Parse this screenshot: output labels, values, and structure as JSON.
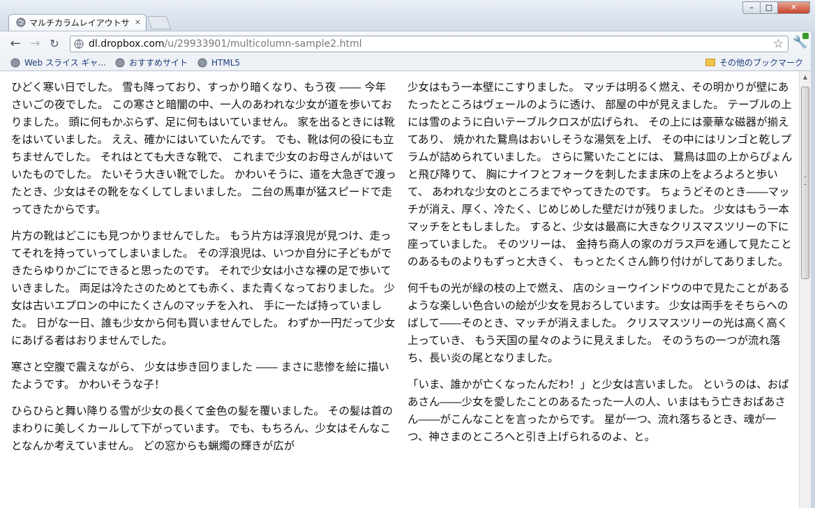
{
  "browser": {
    "tab_title": "マルチカラムレイアウトサ",
    "tab_close": "×",
    "url_host": "dl.dropbox.com",
    "url_path": "/u/29933901/multicolumn-sample2.html",
    "bookmarks": [
      {
        "label": "Web スライス ギャ..."
      },
      {
        "label": "おすすめサイト"
      },
      {
        "label": "HTML5"
      }
    ],
    "other_bookmarks": "その他のブックマーク"
  },
  "article": {
    "paragraphs": [
      "ひどく寒い日でした。 雪も降っており、すっかり暗くなり、もう夜 ―― 今年さいごの夜でした。 この寒さと暗闇の中、一人のあわれな少女が道を歩いておりました。 頭に何もかぶらず、足に何もはいていません。 家を出るときには靴をはいていました。 ええ、確かにはいていたんです。 でも、靴は何の役にも立ちませんでした。 それはとても大きな靴で、 これまで少女のお母さんがはいていたものでした。 たいそう大きい靴でした。 かわいそうに、道を大急ぎで渡ったとき、少女はその靴をなくしてしまいました。 二台の馬車が猛スピードで走ってきたからです。",
      "片方の靴はどこにも見つかりませんでした。 もう片方は浮浪児が見つけ、走ってそれを持っていってしまいました。 その浮浪児は、いつか自分に子どもができたらゆりかごにできると思ったのです。 それで少女は小さな裸の足で歩いていきました。 両足は冷たさのためとても赤く、また青くなっておりました。 少女は古いエプロンの中にたくさんのマッチを入れ、 手に一たば持っていました。 日がな一日、誰も少女から何も買いませんでした。 わずか一円だって少女にあげる者はおりませんでした。",
      "寒さと空腹で震えながら、 少女は歩き回りました ―― まさに悲惨を絵に描いたようです。 かわいそうな子！",
      "ひらひらと舞い降りる雪が少女の長くて金色の髪を覆いました。 その髪は首のまわりに美しくカールして下がっています。 でも、もちろん、少女はそんなことなんか考えていません。 どの窓からも蝋燭の輝きが広が",
      "少女はもう一本壁にこすりました。 マッチは明るく燃え、その明かりが壁にあたったところはヴェールのように透け、 部屋の中が見えました。 テーブルの上には雪のように白いテーブルクロスが広げられ、 その上には豪華な磁器が揃えてあり、 焼かれた鵞鳥はおいしそうな湯気を上げ、 その中にはリンゴと乾しプラムが詰められていました。 さらに驚いたことには、 鵞鳥は皿の上からぴょんと飛び降りて、 胸にナイフとフォークを刺したまま床の上をよろよろと歩いて、 あわれな少女のところまでやってきたのです。 ちょうどそのとき――マッチが消え、厚く、冷たく、じめじめした壁だけが残りました。 少女はもう一本マッチをともしました。 すると、少女は最高に大きなクリスマスツリーの下に座っていました。 そのツリーは、 金持ち商人の家のガラス戸を通して見たことのあるものよりもずっと大きく、 もっとたくさん飾り付けがしてありました。",
      "何千もの光が緑の枝の上で燃え、 店のショーウインドウの中で見たことがあるような楽しい色合いの絵が少女を見おろしています。 少女は両手をそちらへのばして――そのとき、マッチが消えました。 クリスマスツリーの光は高く高く上っていき、 もう天国の星々のように見えました。 そのうちの一つが流れ落ち、長い炎の尾となりました。",
      "「いま、誰かが亡くなったんだわ！」と少女は言いました。 というのは、おばあさん――少女を愛したことのあるたった一人の人、いまはもう亡きおばあさん――がこんなことを言ったからです。 星が一つ、流れ落ちるとき、魂が一つ、神さまのところへと引き上げられるのよ、と。"
    ]
  }
}
